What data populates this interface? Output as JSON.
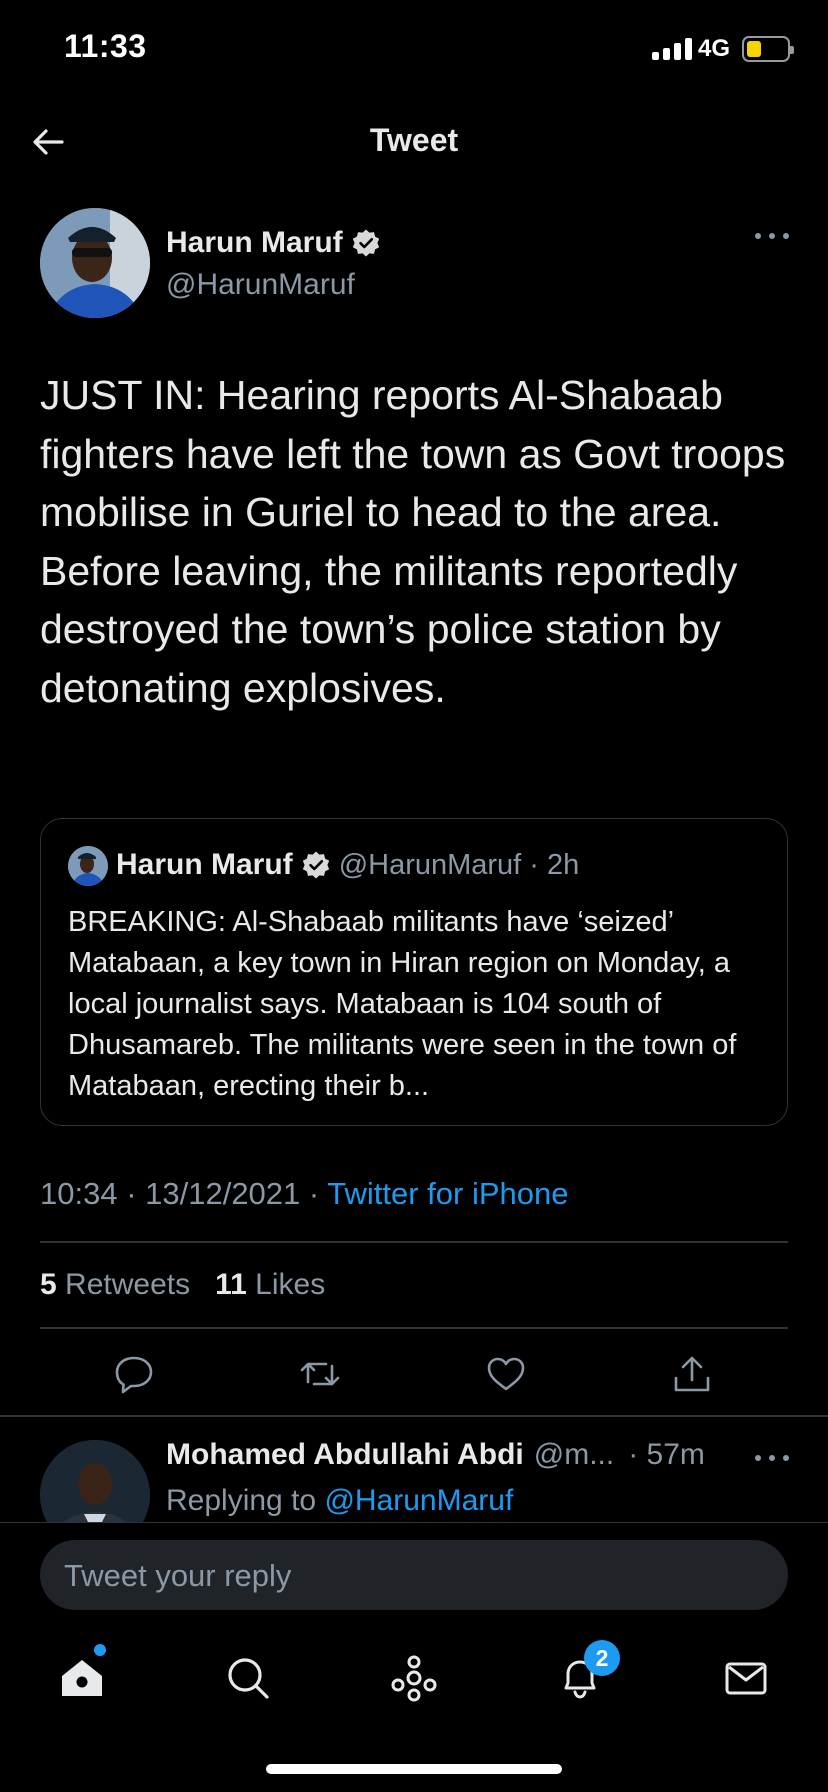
{
  "status_bar": {
    "time": "11:33",
    "network": "4G"
  },
  "header": {
    "title": "Tweet"
  },
  "tweet": {
    "author_name": "Harun Maruf",
    "author_handle": "@HarunMaruf",
    "text": "JUST IN: Hearing reports Al-Shabaab fighters have left the town as Govt troops mobilise in Guriel to head to the area. Before leaving, the militants reportedly destroyed the town’s police station by detonating explosives.",
    "timestamp": "10:34 · 13/12/2021 · ",
    "source": "Twitter for iPhone",
    "retweets_count": "5",
    "retweets_label": "Retweets",
    "likes_count": "11",
    "likes_label": "Likes"
  },
  "quoted_tweet": {
    "author_name": "Harun Maruf",
    "author_handle": "@HarunMaruf",
    "time": "· 2h",
    "text": "BREAKING: Al-Shabaab militants have ‘seized’ Matabaan, a key town in Hiran region on Monday, a local journalist says. Matabaan is 104 south of Dhusamareb. The militants were seen in the town of Matabaan, erecting their b..."
  },
  "reply": {
    "author_name": "Mohamed  Abdullahi Abdi",
    "author_handle": "@m...",
    "time": "· 57m",
    "replying_prefix": "Replying to ",
    "replying_to": "@HarunMaruf"
  },
  "compose": {
    "placeholder": "Tweet your reply"
  },
  "bottom_nav": {
    "items": [
      "home-icon",
      "search-icon",
      "spaces-icon",
      "notifications-icon",
      "messages-icon"
    ],
    "notifications_badge": "2"
  },
  "colors": {
    "accent": "#1d9bf0",
    "background": "#000000",
    "secondary_text": "#8b98a5",
    "battery": "#f5d400"
  }
}
